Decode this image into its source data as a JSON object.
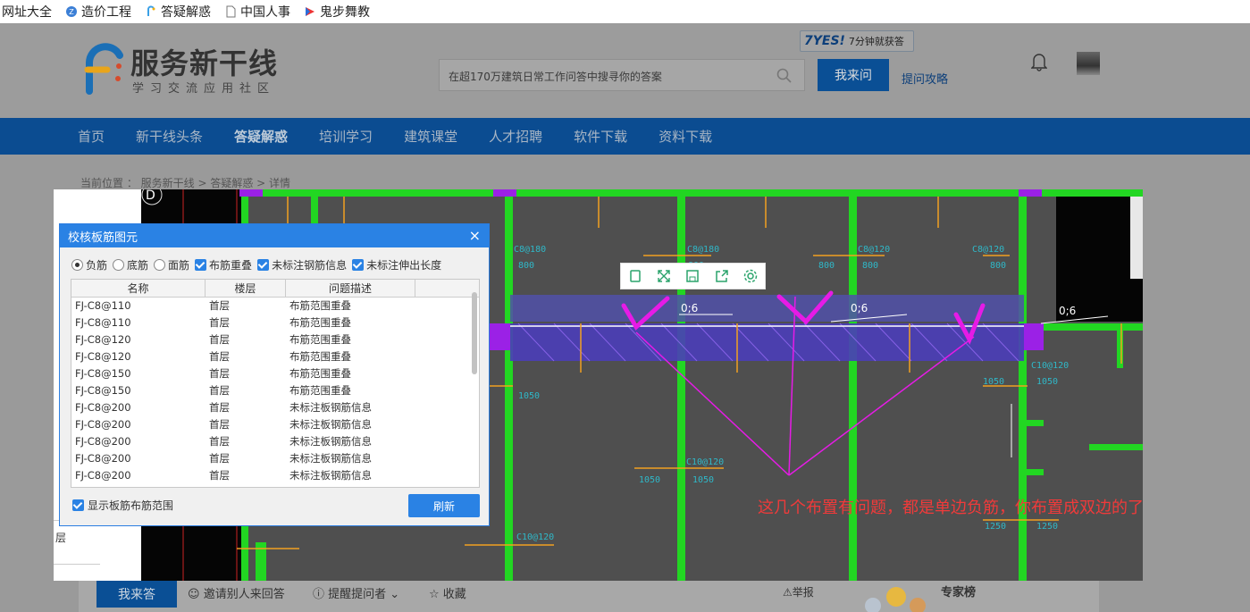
{
  "bookmarks": [
    {
      "label": "网址大全",
      "icon": "none"
    },
    {
      "label": "造价工程",
      "icon": "blue-circle-icon"
    },
    {
      "label": "答疑解惑",
      "icon": "colorful-f-icon"
    },
    {
      "label": "中国人事",
      "icon": "page-icon"
    },
    {
      "label": "鬼步舞教",
      "icon": "video-icon"
    }
  ],
  "header": {
    "logo_name": "服务新干线",
    "logo_sub": "学习交流应用社区",
    "search_placeholder": "在超170万建筑日常工作问答中搜寻你的答案",
    "ask_button": "我来问",
    "promo_brand": "7YES!",
    "promo_text": "7分钟就获答",
    "tips_link": "提问攻略"
  },
  "nav": {
    "items": [
      "首页",
      "新干线头条",
      "答疑解惑",
      "培训学习",
      "建筑课堂",
      "人才招聘",
      "软件下载",
      "资料下载"
    ],
    "active": "答疑解惑"
  },
  "breadcrumb": "当前位置 ： 服务新干线 > 答疑解惑 > 详情",
  "dialog": {
    "title": "校核板筋图元",
    "close": "×",
    "radios": [
      {
        "label": "负筋",
        "checked": true
      },
      {
        "label": "底筋",
        "checked": false
      },
      {
        "label": "面筋",
        "checked": false
      }
    ],
    "checks": [
      "布筋重叠",
      "未标注钢筋信息",
      "未标注伸出长度"
    ],
    "columns": [
      "名称",
      "楼层",
      "问题描述"
    ],
    "rows": [
      [
        "FJ-C8@110",
        "首层",
        "布筋范围重叠"
      ],
      [
        "FJ-C8@110",
        "首层",
        "布筋范围重叠"
      ],
      [
        "FJ-C8@120",
        "首层",
        "布筋范围重叠"
      ],
      [
        "FJ-C8@120",
        "首层",
        "布筋范围重叠"
      ],
      [
        "FJ-C8@150",
        "首层",
        "布筋范围重叠"
      ],
      [
        "FJ-C8@150",
        "首层",
        "布筋范围重叠"
      ],
      [
        "FJ-C8@200",
        "首层",
        "未标注板钢筋信息"
      ],
      [
        "FJ-C8@200",
        "首层",
        "未标注板钢筋信息"
      ],
      [
        "FJ-C8@200",
        "首层",
        "未标注板钢筋信息"
      ],
      [
        "FJ-C8@200",
        "首层",
        "未标注板钢筋信息"
      ],
      [
        "FJ-C8@200",
        "首层",
        "未标注板钢筋信息"
      ]
    ],
    "show_range": "显示板筋布筋范围",
    "refresh": "刷新"
  },
  "cad": {
    "labels": [
      "C8@180",
      "C8@180",
      "C8@120",
      "C8@120",
      "C10@120",
      "C10@120",
      "C10@120"
    ],
    "dims": [
      "800",
      "800",
      "800",
      "800",
      "800",
      "800",
      "1050",
      "1050",
      "1050",
      "1050",
      "1050",
      "1250",
      "1250"
    ],
    "rebar_mark": "0;6",
    "axis": "D",
    "side_label": "层"
  },
  "annotation": "这几个布置有问题，都是单边负筋，你布置成双边的了",
  "bottom": {
    "ask": "我来答",
    "invite": "邀请别人来回答",
    "remind": "提醒提问者",
    "collect": "收藏",
    "report": "举报",
    "expert": "专家榜"
  },
  "colors": {
    "nav": "#0b4c91",
    "accent": "#2a82e4",
    "annotation": "#f03a3a",
    "magenta": "#e61be6",
    "green": "#22d622"
  }
}
